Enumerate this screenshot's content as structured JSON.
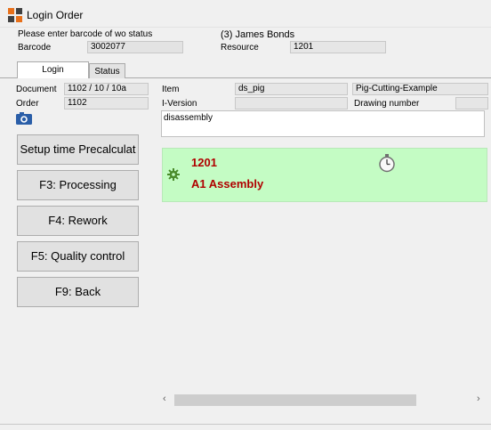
{
  "window": {
    "title": "Login Order"
  },
  "header": {
    "prompt": "Please enter barcode of wo status",
    "barcode_label": "Barcode",
    "barcode_value": "3002077",
    "user": "(3) James Bonds",
    "resource_label": "Resource",
    "resource_value": "1201"
  },
  "tabs": [
    {
      "label": "Login",
      "active": true
    },
    {
      "label": "Status",
      "active": false
    }
  ],
  "details": {
    "document_label": "Document",
    "document_value": "1102 / 10 / 10a",
    "order_label": "Order",
    "order_value": "1102",
    "item_label": "Item",
    "item_value": "ds_pig",
    "item_desc": "Pig-Cutting-Example",
    "iversion_label": "I-Version",
    "iversion_value": "",
    "drawing_label": "Drawing number",
    "drawing_value": "",
    "notes": "disassembly"
  },
  "actions": [
    {
      "label": "Setup time Precalculat"
    },
    {
      "label": "F3: Processing"
    },
    {
      "label": "F4: Rework"
    },
    {
      "label": "F5: Quality control"
    },
    {
      "label": "F9: Back"
    }
  ],
  "operation": {
    "number": "1201",
    "name": "A1 Assembly",
    "background": "#c4fcc4",
    "text_color": "#b00000"
  },
  "icons": {
    "app": "app-logo-icon",
    "camera": "camera-icon",
    "timer": "stopwatch-icon",
    "gear": "gear-icon"
  }
}
